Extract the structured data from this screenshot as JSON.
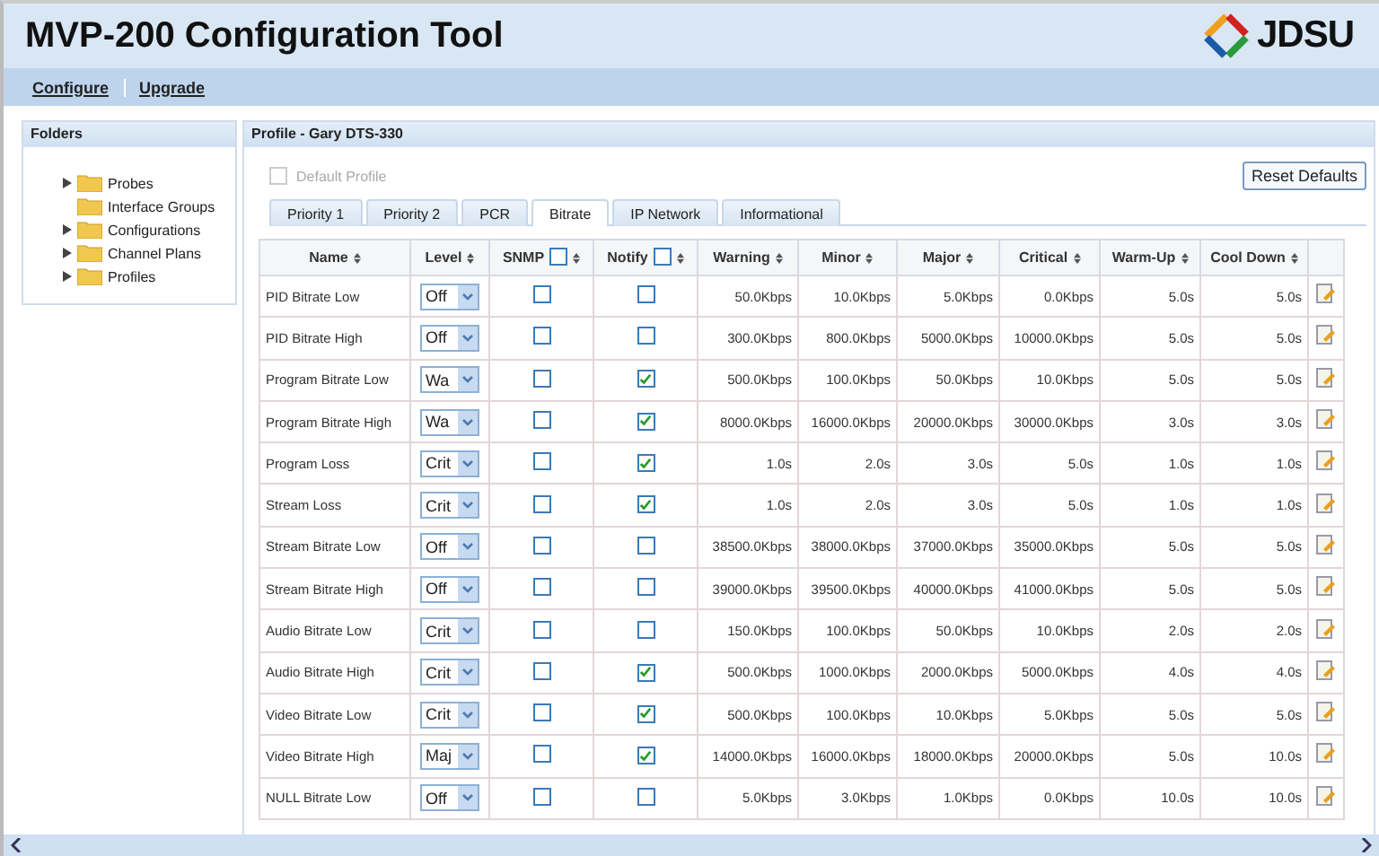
{
  "app_title": "MVP-200 Configuration Tool",
  "logo": "JDSU",
  "menu": [
    {
      "label": "Configure"
    },
    {
      "label": "Upgrade"
    }
  ],
  "folders": {
    "title": "Folders",
    "items": [
      {
        "label": "Probes",
        "expandable": true
      },
      {
        "label": "Interface Groups",
        "expandable": false
      },
      {
        "label": "Configurations",
        "expandable": true
      },
      {
        "label": "Channel Plans",
        "expandable": true
      },
      {
        "label": "Profiles",
        "expandable": true
      }
    ]
  },
  "profile": {
    "title": "Profile - Gary DTS-330",
    "default_profile": {
      "label": "Default Profile",
      "checked": false,
      "disabled": true
    },
    "reset_button": "Reset Defaults",
    "tabs": [
      {
        "label": "Priority 1",
        "selected": false
      },
      {
        "label": "Priority 2",
        "selected": false
      },
      {
        "label": "PCR",
        "selected": false
      },
      {
        "label": "Bitrate",
        "selected": true
      },
      {
        "label": "IP Network",
        "selected": false
      },
      {
        "label": "Informational",
        "selected": false
      }
    ],
    "columns": [
      {
        "label": "Name",
        "kind": "text"
      },
      {
        "label": "Level",
        "kind": "select"
      },
      {
        "label": "SNMP",
        "kind": "check",
        "checked": false
      },
      {
        "label": "Notify",
        "kind": "check",
        "checked": false
      },
      {
        "label": "Warning",
        "kind": "text"
      },
      {
        "label": "Minor",
        "kind": "text"
      },
      {
        "label": "Major",
        "kind": "text"
      },
      {
        "label": "Critical",
        "kind": "text"
      },
      {
        "label": "Warm-Up",
        "kind": "text"
      },
      {
        "label": "Cool Down",
        "kind": "text"
      }
    ],
    "rows": [
      {
        "name": "PID Bitrate Low",
        "level": "Off",
        "snmp": false,
        "notify": false,
        "values": [
          "50.0Kbps",
          "10.0Kbps",
          "5.0Kbps",
          "0.0Kbps",
          "5.0s",
          "5.0s"
        ]
      },
      {
        "name": "PID Bitrate High",
        "level": "Off",
        "snmp": false,
        "notify": false,
        "values": [
          "300.0Kbps",
          "800.0Kbps",
          "5000.0Kbps",
          "10000.0Kbps",
          "5.0s",
          "5.0s"
        ]
      },
      {
        "name": "Program Bitrate Low",
        "level": "Wa",
        "snmp": false,
        "notify": true,
        "values": [
          "500.0Kbps",
          "100.0Kbps",
          "50.0Kbps",
          "10.0Kbps",
          "5.0s",
          "5.0s"
        ]
      },
      {
        "name": "Program Bitrate High",
        "level": "Wa",
        "snmp": false,
        "notify": true,
        "values": [
          "8000.0Kbps",
          "16000.0Kbps",
          "20000.0Kbps",
          "30000.0Kbps",
          "3.0s",
          "3.0s"
        ]
      },
      {
        "name": "Program Loss",
        "level": "Crit",
        "snmp": false,
        "notify": true,
        "values": [
          "1.0s",
          "2.0s",
          "3.0s",
          "5.0s",
          "1.0s",
          "1.0s"
        ]
      },
      {
        "name": "Stream Loss",
        "level": "Crit",
        "snmp": false,
        "notify": true,
        "values": [
          "1.0s",
          "2.0s",
          "3.0s",
          "5.0s",
          "1.0s",
          "1.0s"
        ]
      },
      {
        "name": "Stream Bitrate Low",
        "level": "Off",
        "snmp": false,
        "notify": false,
        "values": [
          "38500.0Kbps",
          "38000.0Kbps",
          "37000.0Kbps",
          "35000.0Kbps",
          "5.0s",
          "5.0s"
        ]
      },
      {
        "name": "Stream Bitrate High",
        "level": "Off",
        "snmp": false,
        "notify": false,
        "values": [
          "39000.0Kbps",
          "39500.0Kbps",
          "40000.0Kbps",
          "41000.0Kbps",
          "5.0s",
          "5.0s"
        ]
      },
      {
        "name": "Audio Bitrate Low",
        "level": "Crit",
        "snmp": false,
        "notify": false,
        "values": [
          "150.0Kbps",
          "100.0Kbps",
          "50.0Kbps",
          "10.0Kbps",
          "2.0s",
          "2.0s"
        ]
      },
      {
        "name": "Audio Bitrate High",
        "level": "Crit",
        "snmp": false,
        "notify": true,
        "values": [
          "500.0Kbps",
          "1000.0Kbps",
          "2000.0Kbps",
          "5000.0Kbps",
          "4.0s",
          "4.0s"
        ]
      },
      {
        "name": "Video Bitrate Low",
        "level": "Crit",
        "snmp": false,
        "notify": true,
        "values": [
          "500.0Kbps",
          "100.0Kbps",
          "10.0Kbps",
          "5.0Kbps",
          "5.0s",
          "5.0s"
        ]
      },
      {
        "name": "Video Bitrate High",
        "level": "Maj",
        "snmp": false,
        "notify": true,
        "values": [
          "14000.0Kbps",
          "16000.0Kbps",
          "18000.0Kbps",
          "20000.0Kbps",
          "5.0s",
          "10.0s"
        ]
      },
      {
        "name": "NULL Bitrate Low",
        "level": "Off",
        "snmp": false,
        "notify": false,
        "values": [
          "5.0Kbps",
          "3.0Kbps",
          "1.0Kbps",
          "0.0Kbps",
          "10.0s",
          "10.0s"
        ]
      }
    ]
  }
}
